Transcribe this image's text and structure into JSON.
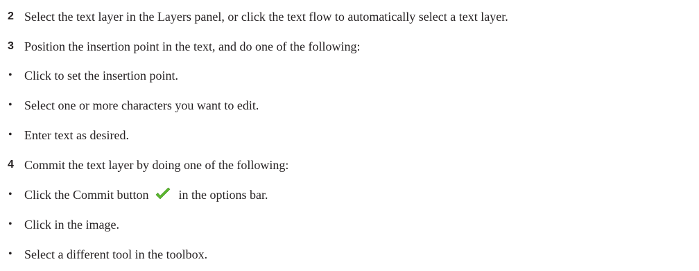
{
  "steps": [
    {
      "number": "2",
      "text": "Select the text layer in the Layers panel, or click the text flow to automatically select a text layer."
    },
    {
      "number": "3",
      "text": "Position the insertion point in the text, and do one of the following:"
    },
    {
      "number": "4",
      "text": "Commit the text layer by doing one of the following:"
    }
  ],
  "step3_bullets": [
    "Click to set the insertion point.",
    "Select one or more characters you want to edit.",
    "Enter text as desired."
  ],
  "step4_bullets": {
    "commit_before": "Click the Commit button",
    "commit_after": "in the options bar.",
    "commit_icon": "checkmark-icon",
    "commit_icon_color": "#5cb82e",
    "image": "Click in the image.",
    "tool": "Select a different tool in the toolbox."
  },
  "bullet_symbol": "•"
}
